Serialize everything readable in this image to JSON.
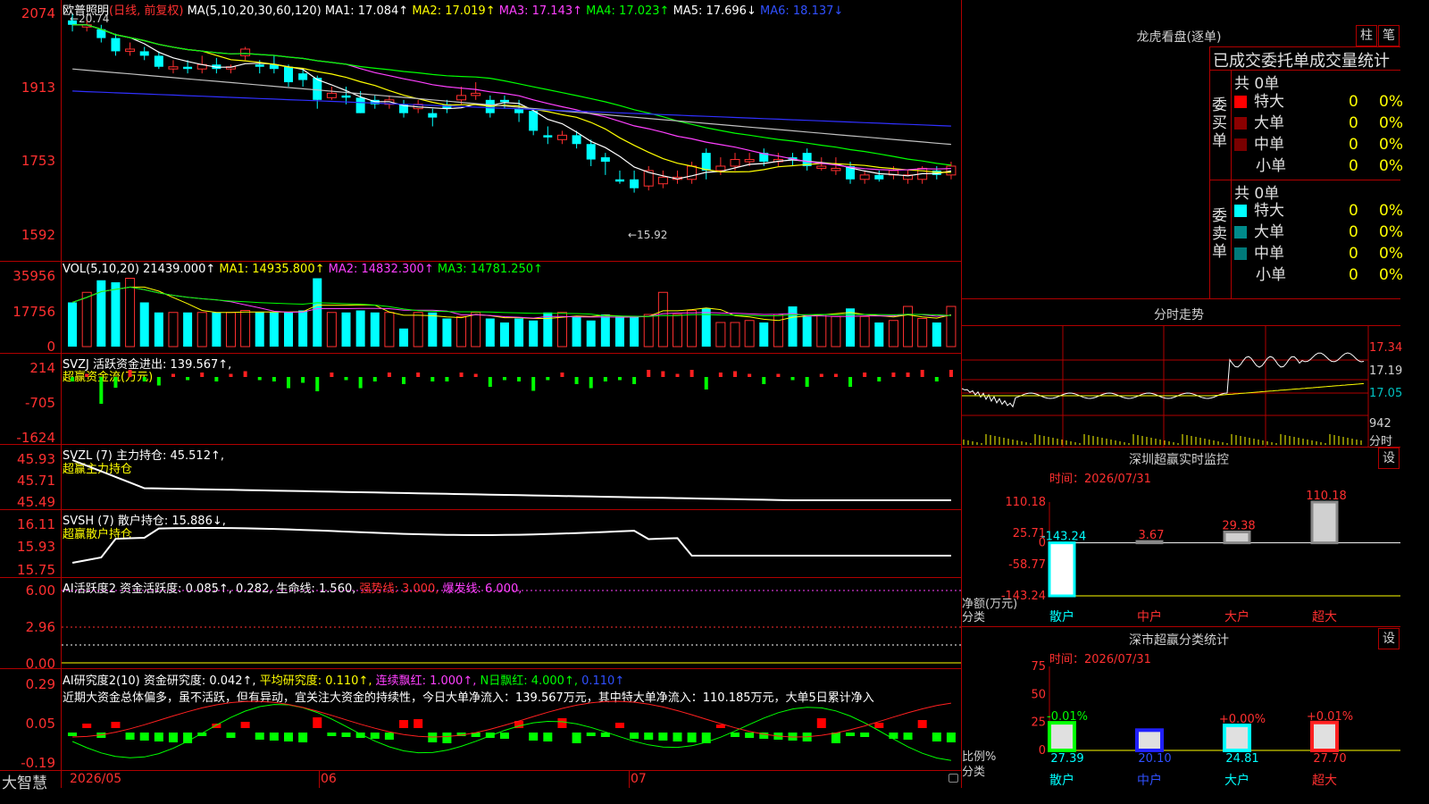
{
  "stock": {
    "name": "欧普照明",
    "mode": "(日线, 前复权)",
    "hi_label": "←20.74",
    "lo_label": "←15.92"
  },
  "ma_header": {
    "params": "MA(5,10,20,30,60,120)",
    "ma1": "MA1: 17.084↑",
    "ma2": "MA2: 17.019↑",
    "ma3": "MA3: 17.143↑",
    "ma4": "MA4: 17.023↑",
    "ma5": "MA5: 17.696↓",
    "ma6": "MA6: 18.137↓"
  },
  "price_axis": [
    "2074",
    "1913",
    "1753",
    "1592"
  ],
  "vol_header": {
    "params": "VOL(5,10,20)",
    "v": "21439.000↑",
    "ma1": "MA1: 14935.800↑",
    "ma2": "MA2: 14832.300↑",
    "ma3": "MA3: 14781.250↑"
  },
  "vol_axis": [
    "35956",
    "17756",
    "0"
  ],
  "svzj": {
    "title": "SVZJ  活跃资金进出: 139.567↑,",
    "sub": "超赢资金流(万元)",
    "axis": [
      "214",
      "-705",
      "-1624"
    ]
  },
  "svzl": {
    "title": "SVZL (7) 主力持仓: 45.512↑,",
    "sub": "超赢主力持仓",
    "axis": [
      "45.93",
      "45.71",
      "45.49"
    ]
  },
  "svsh": {
    "title": "SVSH (7) 散户持仓: 15.886↓,",
    "sub": "超赢散户持仓",
    "axis": [
      "16.11",
      "15.93",
      "15.75"
    ]
  },
  "ai1": {
    "t1": "AI活跃度2 资金活跃度: 0.085↑, 0.282,",
    "t2": " 生命线: 1.560,",
    "t3": " 强势线: 3.000,",
    "t4": " 爆发线: 6.000,",
    "axis": [
      "6.00",
      "2.96",
      "0.00"
    ]
  },
  "ai2": {
    "t1": "AI研究度2(10) 资金研究度: 0.042↑,",
    "t2": " 平均研究度: 0.110↑,",
    "t3": " 连续飘红: 1.000↑,",
    "t4": " N日飘红: 4.000↑,",
    "t5": " 0.110↑",
    "desc": "近期大资金总体偏多，虽不活跃，但有异动，宜关注大资金的持续性，今日大单净流入：139.567万元，其中特大单净流入：110.185万元，大单5日累计净入",
    "axis": [
      "0.29",
      "0.05",
      "-0.19"
    ]
  },
  "dates": [
    "2026/05",
    "06",
    "07"
  ],
  "brand": "大智慧",
  "lhb": {
    "title": "龙虎看盘(逐单)",
    "btn1": "柱",
    "btn2": "笔",
    "stat_title": "已成交委托单成交量统计",
    "buy_total": "共 0单",
    "sell_total": "共 0单",
    "buy_label": "委买单",
    "sell_label": "委卖单",
    "rows": [
      {
        "name": "特大",
        "n": "0",
        "p": "0%"
      },
      {
        "name": "大单",
        "n": "0",
        "p": "0%"
      },
      {
        "name": "中单",
        "n": "0",
        "p": "0%"
      },
      {
        "name": "小单",
        "n": "0",
        "p": "0%"
      }
    ],
    "buy_colors": [
      "#ff0000",
      "#8b0000",
      "#7a0000",
      "#000000"
    ],
    "sell_colors": [
      "#00ffff",
      "#008b8b",
      "#007a7a",
      "#000000"
    ]
  },
  "fenshi": {
    "title": "分时走势",
    "axis": [
      "17.34",
      "17.19",
      "17.05"
    ],
    "vol_label": "942",
    "vol_unit": "分时"
  },
  "monitor": {
    "title": "深圳超赢实时监控",
    "btn": "设",
    "time": "时间：2026/07/31",
    "axis": [
      "110.18",
      "25.71",
      "0",
      "-58.77",
      "-143.24"
    ],
    "ylabel": "净额(万元)",
    "xlabel": "分类",
    "bars": [
      {
        "cat": "散户",
        "value": -143.24,
        "label": "-143.24"
      },
      {
        "cat": "中户",
        "value": 3.67,
        "label": "3.67"
      },
      {
        "cat": "大户",
        "value": 29.38,
        "label": "29.38"
      },
      {
        "cat": "超大",
        "value": 110.18,
        "label": "110.18"
      }
    ]
  },
  "classify": {
    "title": "深市超赢分类统计",
    "btn": "设",
    "time": "时间：2026/07/31",
    "axis": [
      "75",
      "50",
      "25",
      "0"
    ],
    "ylabel": "比例%",
    "xlabel": "分类",
    "bars": [
      {
        "cat": "散户",
        "value": 27.39,
        "delta": "-0.01%",
        "color": "#00ff00"
      },
      {
        "cat": "中户",
        "value": 20.1,
        "delta": "",
        "color": "#2020ff"
      },
      {
        "cat": "大户",
        "value": 24.81,
        "delta": "+0.00%",
        "color": "#00ffff"
      },
      {
        "cat": "超大",
        "value": 27.7,
        "delta": "+0.01%",
        "color": "#ff2020"
      }
    ]
  },
  "chart_data": {
    "type": "candlestick",
    "candles": [
      [
        20.6,
        20.5,
        20.74,
        20.35
      ],
      [
        20.45,
        20.5,
        20.6,
        20.35
      ],
      [
        20.4,
        20.2,
        20.5,
        20.1
      ],
      [
        20.2,
        19.9,
        20.3,
        19.8
      ],
      [
        19.9,
        19.95,
        20.1,
        19.8
      ],
      [
        19.9,
        19.8,
        20.0,
        19.7
      ],
      [
        19.8,
        19.55,
        19.9,
        19.5
      ],
      [
        19.5,
        19.55,
        19.7,
        19.4
      ],
      [
        19.55,
        19.5,
        19.7,
        19.4
      ],
      [
        19.5,
        19.6,
        19.8,
        19.4
      ],
      [
        19.6,
        19.5,
        19.75,
        19.4
      ],
      [
        19.5,
        19.55,
        19.6,
        19.4
      ],
      [
        19.8,
        19.95,
        20.0,
        19.7
      ],
      [
        19.6,
        19.55,
        19.7,
        19.4
      ],
      [
        19.6,
        19.5,
        19.8,
        19.4
      ],
      [
        19.55,
        19.2,
        19.6,
        19.1
      ],
      [
        19.4,
        19.25,
        19.5,
        19.1
      ],
      [
        19.3,
        18.8,
        19.35,
        18.6
      ],
      [
        18.85,
        18.95,
        19.1,
        18.8
      ],
      [
        18.9,
        18.85,
        19.1,
        18.7
      ],
      [
        18.85,
        18.5,
        19.0,
        18.5
      ],
      [
        18.8,
        18.7,
        18.9,
        18.6
      ],
      [
        18.7,
        18.8,
        18.9,
        18.6
      ],
      [
        18.7,
        18.5,
        18.8,
        18.4
      ],
      [
        18.6,
        18.7,
        18.8,
        18.5
      ],
      [
        18.5,
        18.4,
        18.6,
        18.2
      ],
      [
        18.7,
        18.6,
        18.8,
        18.5
      ],
      [
        18.8,
        18.9,
        19.1,
        18.7
      ],
      [
        18.9,
        18.95,
        19.2,
        18.8
      ],
      [
        18.8,
        18.5,
        18.9,
        18.4
      ],
      [
        18.8,
        18.75,
        18.9,
        18.6
      ],
      [
        18.6,
        18.5,
        18.8,
        18.3
      ],
      [
        18.55,
        18.1,
        18.6,
        18.0
      ],
      [
        18.0,
        17.95,
        18.2,
        17.8
      ],
      [
        17.9,
        18.0,
        18.1,
        17.8
      ],
      [
        18.0,
        17.8,
        18.1,
        17.7
      ],
      [
        17.8,
        17.45,
        17.9,
        17.3
      ],
      [
        17.5,
        17.4,
        17.6,
        17.1
      ],
      [
        17.0,
        16.95,
        17.2,
        16.9
      ],
      [
        17.0,
        16.8,
        17.2,
        16.7
      ],
      [
        16.85,
        17.2,
        17.3,
        16.75
      ],
      [
        16.9,
        17.05,
        17.2,
        16.8
      ],
      [
        17.0,
        17.05,
        17.2,
        16.9
      ],
      [
        17.0,
        17.3,
        17.4,
        16.9
      ],
      [
        17.6,
        17.2,
        17.7,
        17.0
      ],
      [
        17.2,
        17.3,
        17.5,
        17.1
      ],
      [
        17.3,
        17.45,
        17.6,
        17.2
      ],
      [
        17.4,
        17.45,
        17.6,
        17.3
      ],
      [
        17.6,
        17.4,
        17.7,
        17.3
      ],
      [
        17.4,
        17.45,
        17.6,
        17.3
      ],
      [
        17.5,
        17.45,
        17.6,
        17.3
      ],
      [
        17.6,
        17.3,
        17.7,
        17.2
      ],
      [
        17.25,
        17.3,
        17.5,
        17.2
      ],
      [
        17.2,
        17.25,
        17.5,
        17.1
      ],
      [
        17.3,
        17.0,
        17.4,
        16.9
      ],
      [
        17.0,
        17.1,
        17.2,
        16.9
      ],
      [
        17.1,
        17.0,
        17.2,
        16.95
      ],
      [
        17.1,
        17.2,
        17.3,
        17.0
      ],
      [
        17.0,
        17.1,
        17.2,
        16.9
      ],
      [
        17.0,
        17.25,
        17.3,
        16.9
      ],
      [
        17.2,
        17.1,
        17.3,
        17.0
      ],
      [
        17.1,
        17.3,
        17.4,
        17.0
      ]
    ],
    "volume": [
      22000,
      27000,
      33000,
      32000,
      34000,
      22000,
      17000,
      17000,
      17000,
      17000,
      17000,
      17000,
      18000,
      17000,
      17000,
      17000,
      18000,
      34000,
      17000,
      17000,
      18000,
      17000,
      17000,
      9000,
      17000,
      17000,
      14000,
      15000,
      17000,
      14000,
      12000,
      14000,
      13000,
      17000,
      17000,
      15000,
      13000,
      16000,
      15000,
      15000,
      16000,
      27000,
      16000,
      18000,
      19000,
      12000,
      12000,
      13000,
      12000,
      16000,
      20000,
      15000,
      16000,
      15000,
      19000,
      15000,
      12000,
      13000,
      20000,
      14000,
      12000,
      20000
    ],
    "x_labels": [
      "2026/05",
      "06",
      "07"
    ]
  }
}
